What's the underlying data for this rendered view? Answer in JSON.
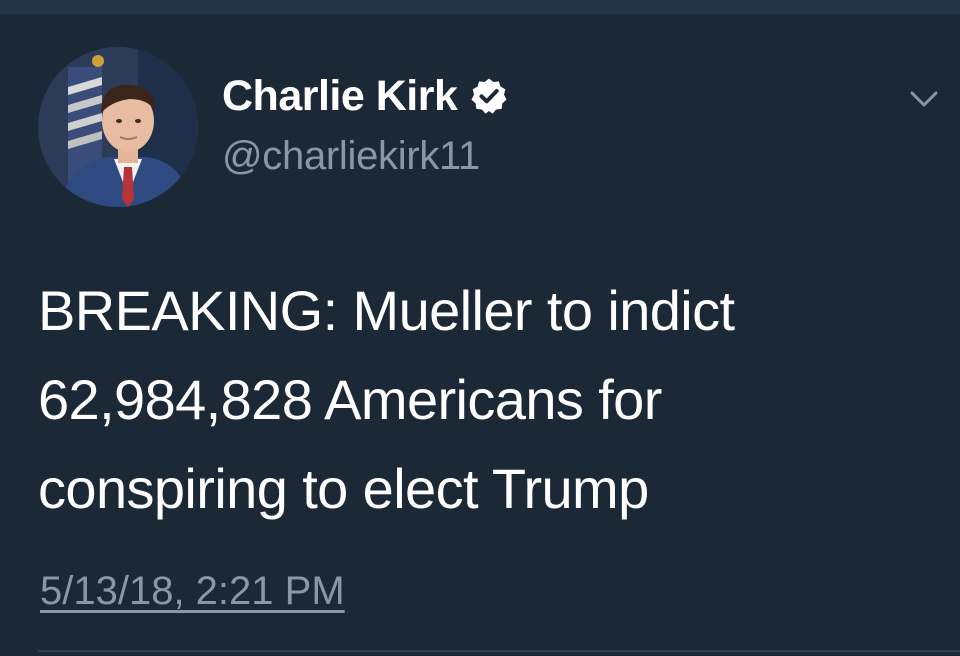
{
  "author": {
    "display_name": "Charlie Kirk",
    "handle": "@charliekirk11",
    "verified": true
  },
  "tweet": {
    "text_lines": [
      "BREAKING: Mueller to indict",
      "62,984,828 Americans for",
      "conspiring to elect Trump"
    ],
    "timestamp": "5/13/18, 2:21 PM"
  },
  "icons": {
    "verified": "verified-badge-icon",
    "more": "chevron-down-icon"
  },
  "colors": {
    "background": "#1b2836",
    "primary_text": "#ffffff",
    "secondary_text": "#8899a6"
  }
}
